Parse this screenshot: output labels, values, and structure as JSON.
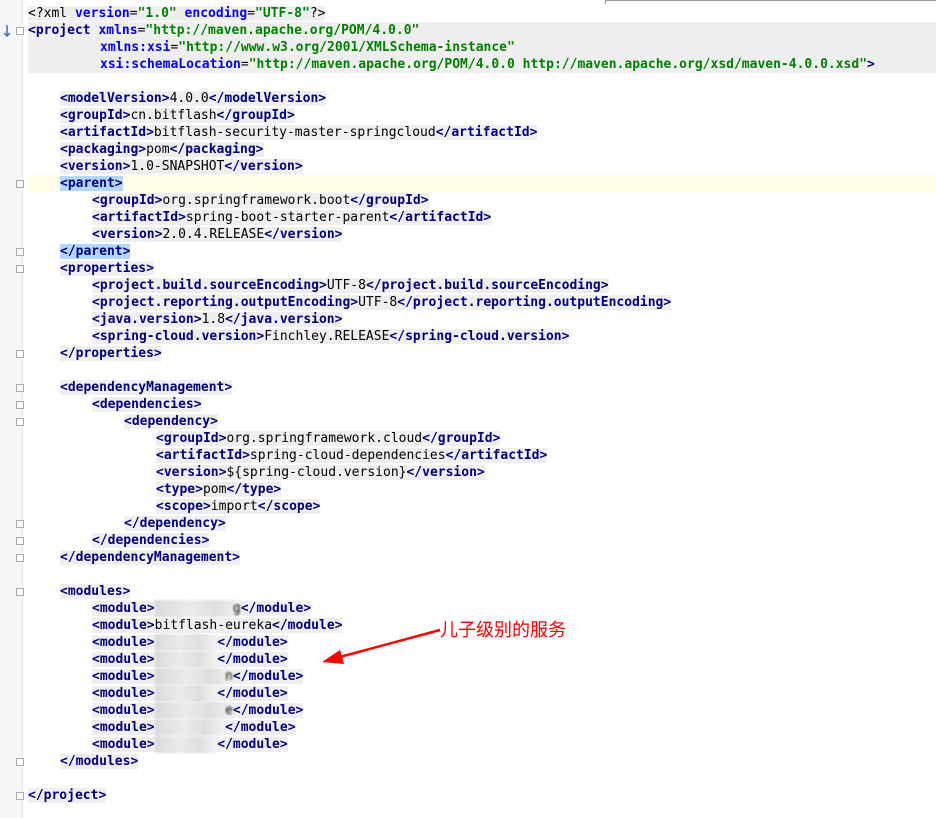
{
  "editor": {
    "lines": [
      {
        "segments": [
          {
            "cls": "pi",
            "text": "<?xml "
          },
          {
            "cls": "attr",
            "text": "version"
          },
          {
            "cls": "txt",
            "text": "="
          },
          {
            "cls": "val",
            "text": "\"1.0\""
          },
          {
            "cls": "attr",
            "text": " encoding"
          },
          {
            "cls": "txt",
            "text": "="
          },
          {
            "cls": "val",
            "text": "\"UTF-8\""
          },
          {
            "cls": "pi",
            "text": "?>"
          }
        ]
      },
      {
        "band": true,
        "segments": [
          {
            "cls": "tag",
            "text": "<project "
          },
          {
            "cls": "attr",
            "text": "xmlns"
          },
          {
            "cls": "txt",
            "text": "="
          },
          {
            "cls": "val",
            "text": "\"http://maven.apache.org/POM/4.0.0\""
          }
        ]
      },
      {
        "band": true,
        "indent": 72,
        "segments": [
          {
            "cls": "attr",
            "text": "xmlns:xsi"
          },
          {
            "cls": "txt",
            "text": "="
          },
          {
            "cls": "val",
            "text": "\"http://www.w3.org/2001/XMLSchema-instance\""
          }
        ]
      },
      {
        "band": true,
        "indent": 72,
        "segments": [
          {
            "cls": "attr",
            "text": "xsi:schemaLocation"
          },
          {
            "cls": "txt",
            "text": "="
          },
          {
            "cls": "val",
            "text": "\"http://maven.apache.org/POM/4.0.0 http://maven.apache.org/xsd/maven-4.0.0.xsd\""
          },
          {
            "cls": "tag",
            "text": ">"
          }
        ]
      },
      {
        "blank": true,
        "segments": []
      },
      {
        "indent": 32,
        "segments": [
          {
            "cls": "tag",
            "text": "<modelVersion>"
          },
          {
            "cls": "txt",
            "text": "4.0.0"
          },
          {
            "cls": "tag",
            "text": "</modelVersion>"
          }
        ]
      },
      {
        "indent": 32,
        "segments": [
          {
            "cls": "tag",
            "text": "<groupId>"
          },
          {
            "cls": "txt",
            "text": "cn.bitflash"
          },
          {
            "cls": "tag",
            "text": "</groupId>"
          }
        ]
      },
      {
        "indent": 32,
        "segments": [
          {
            "cls": "tag",
            "text": "<artifactId>"
          },
          {
            "cls": "txt",
            "text": "bitflash-security-master-springcloud"
          },
          {
            "cls": "tag",
            "text": "</artifactId>"
          }
        ]
      },
      {
        "indent": 32,
        "segments": [
          {
            "cls": "tag",
            "text": "<packaging>"
          },
          {
            "cls": "txt",
            "text": "pom"
          },
          {
            "cls": "tag",
            "text": "</packaging>"
          }
        ]
      },
      {
        "indent": 32,
        "segments": [
          {
            "cls": "tag",
            "text": "<version>"
          },
          {
            "cls": "txt",
            "text": "1.0-SNAPSHOT"
          },
          {
            "cls": "tag",
            "text": "</version>"
          }
        ]
      },
      {
        "caret": true,
        "indent": 32,
        "segments": [
          {
            "cls": "tag hl",
            "text": "<parent>"
          }
        ]
      },
      {
        "indent": 64,
        "segments": [
          {
            "cls": "tag",
            "text": "<groupId>"
          },
          {
            "cls": "txt",
            "text": "org.springframework.boot"
          },
          {
            "cls": "tag",
            "text": "</groupId>"
          }
        ]
      },
      {
        "indent": 64,
        "segments": [
          {
            "cls": "tag",
            "text": "<artifactId>"
          },
          {
            "cls": "txt",
            "text": "spring-boot-starter-parent"
          },
          {
            "cls": "tag",
            "text": "</artifactId>"
          }
        ]
      },
      {
        "indent": 64,
        "segments": [
          {
            "cls": "tag",
            "text": "<version>"
          },
          {
            "cls": "txt",
            "text": "2.0.4.RELEASE"
          },
          {
            "cls": "tag",
            "text": "</version>"
          }
        ]
      },
      {
        "indent": 32,
        "segments": [
          {
            "cls": "tag hl",
            "text": "</parent>"
          }
        ]
      },
      {
        "indent": 32,
        "segments": [
          {
            "cls": "tag",
            "text": "<properties>"
          }
        ]
      },
      {
        "indent": 64,
        "segments": [
          {
            "cls": "tag",
            "text": "<project.build.sourceEncoding>"
          },
          {
            "cls": "txt",
            "text": "UTF-8"
          },
          {
            "cls": "tag",
            "text": "</project.build.sourceEncoding>"
          }
        ]
      },
      {
        "indent": 64,
        "segments": [
          {
            "cls": "tag",
            "text": "<project.reporting.outputEncoding>"
          },
          {
            "cls": "txt",
            "text": "UTF-8"
          },
          {
            "cls": "tag",
            "text": "</project.reporting.outputEncoding>"
          }
        ]
      },
      {
        "indent": 64,
        "segments": [
          {
            "cls": "tag",
            "text": "<java.version>"
          },
          {
            "cls": "txt",
            "text": "1.8"
          },
          {
            "cls": "tag",
            "text": "</java.version>"
          }
        ]
      },
      {
        "indent": 64,
        "segments": [
          {
            "cls": "tag",
            "text": "<spring-cloud.version>"
          },
          {
            "cls": "txt",
            "text": "Finchley.RELEASE"
          },
          {
            "cls": "tag",
            "text": "</spring-cloud.version>"
          }
        ]
      },
      {
        "indent": 32,
        "segments": [
          {
            "cls": "tag",
            "text": "</properties>"
          }
        ]
      },
      {
        "blank": true,
        "segments": []
      },
      {
        "indent": 32,
        "segments": [
          {
            "cls": "tag",
            "text": "<dependencyManagement>"
          }
        ]
      },
      {
        "indent": 64,
        "segments": [
          {
            "cls": "tag",
            "text": "<dependencies>"
          }
        ]
      },
      {
        "indent": 96,
        "segments": [
          {
            "cls": "tag",
            "text": "<dependency>"
          }
        ]
      },
      {
        "indent": 128,
        "segments": [
          {
            "cls": "tag",
            "text": "<groupId>"
          },
          {
            "cls": "txt",
            "text": "org.springframework.cloud"
          },
          {
            "cls": "tag",
            "text": "</groupId>"
          }
        ]
      },
      {
        "indent": 128,
        "segments": [
          {
            "cls": "tag",
            "text": "<artifactId>"
          },
          {
            "cls": "txt",
            "text": "spring-cloud-dependencies"
          },
          {
            "cls": "tag",
            "text": "</artifactId>"
          }
        ]
      },
      {
        "indent": 128,
        "segments": [
          {
            "cls": "tag",
            "text": "<version>"
          },
          {
            "cls": "txt",
            "text": "${spring-cloud.version}"
          },
          {
            "cls": "tag",
            "text": "</version>"
          }
        ]
      },
      {
        "indent": 128,
        "segments": [
          {
            "cls": "tag",
            "text": "<type>"
          },
          {
            "cls": "txt",
            "text": "pom"
          },
          {
            "cls": "tag",
            "text": "</type>"
          }
        ]
      },
      {
        "indent": 128,
        "segments": [
          {
            "cls": "tag",
            "text": "<scope>"
          },
          {
            "cls": "txt",
            "text": "import"
          },
          {
            "cls": "tag",
            "text": "</scope>"
          }
        ]
      },
      {
        "indent": 96,
        "segments": [
          {
            "cls": "tag",
            "text": "</dependency>"
          }
        ]
      },
      {
        "indent": 64,
        "segments": [
          {
            "cls": "tag",
            "text": "</dependencies>"
          }
        ]
      },
      {
        "indent": 32,
        "segments": [
          {
            "cls": "tag",
            "text": "</dependencyManagement>"
          }
        ]
      },
      {
        "blank": true,
        "segments": []
      },
      {
        "indent": 32,
        "segments": [
          {
            "cls": "tag",
            "text": "<modules>"
          }
        ]
      },
      {
        "indent": 64,
        "segments": [
          {
            "cls": "tag",
            "text": "<module>"
          },
          {
            "cls": "blur",
            "text": "          g"
          },
          {
            "cls": "tag",
            "text": "</module>"
          }
        ]
      },
      {
        "indent": 64,
        "segments": [
          {
            "cls": "tag",
            "text": "<module>"
          },
          {
            "cls": "txt",
            "text": "bitflash-eureka"
          },
          {
            "cls": "tag",
            "text": "</module>"
          }
        ]
      },
      {
        "indent": 64,
        "segments": [
          {
            "cls": "tag",
            "text": "<module>"
          },
          {
            "cls": "blur",
            "text": "        "
          },
          {
            "cls": "tag",
            "text": "</module>"
          }
        ]
      },
      {
        "indent": 64,
        "segments": [
          {
            "cls": "tag",
            "text": "<module>"
          },
          {
            "cls": "blur",
            "text": "        "
          },
          {
            "cls": "tag",
            "text": "</module>"
          }
        ]
      },
      {
        "indent": 64,
        "segments": [
          {
            "cls": "tag",
            "text": "<module>"
          },
          {
            "cls": "blur",
            "text": "         n"
          },
          {
            "cls": "tag",
            "text": "</module>"
          }
        ]
      },
      {
        "indent": 64,
        "segments": [
          {
            "cls": "tag",
            "text": "<module>"
          },
          {
            "cls": "blur",
            "text": "        "
          },
          {
            "cls": "tag",
            "text": "</module>"
          }
        ]
      },
      {
        "indent": 64,
        "segments": [
          {
            "cls": "tag",
            "text": "<module>"
          },
          {
            "cls": "blur",
            "text": "         e"
          },
          {
            "cls": "tag",
            "text": "</module>"
          }
        ]
      },
      {
        "indent": 64,
        "segments": [
          {
            "cls": "tag",
            "text": "<module>"
          },
          {
            "cls": "blur",
            "text": "         "
          },
          {
            "cls": "tag",
            "text": "</module>"
          }
        ]
      },
      {
        "indent": 64,
        "segments": [
          {
            "cls": "tag",
            "text": "<module>"
          },
          {
            "cls": "blur",
            "text": "        "
          },
          {
            "cls": "tag",
            "text": "</module>"
          }
        ]
      },
      {
        "indent": 32,
        "segments": [
          {
            "cls": "tag",
            "text": "</modules>"
          }
        ]
      },
      {
        "blank": true,
        "segments": []
      },
      {
        "segments": [
          {
            "cls": "tag",
            "text": "</project>"
          }
        ]
      }
    ]
  },
  "annotation": {
    "text": "儿子级别的服务",
    "color": "#ff0000"
  },
  "icons": {
    "gutter_arrow": "arrow-down-icon",
    "fold": "fold-marker-icon"
  }
}
